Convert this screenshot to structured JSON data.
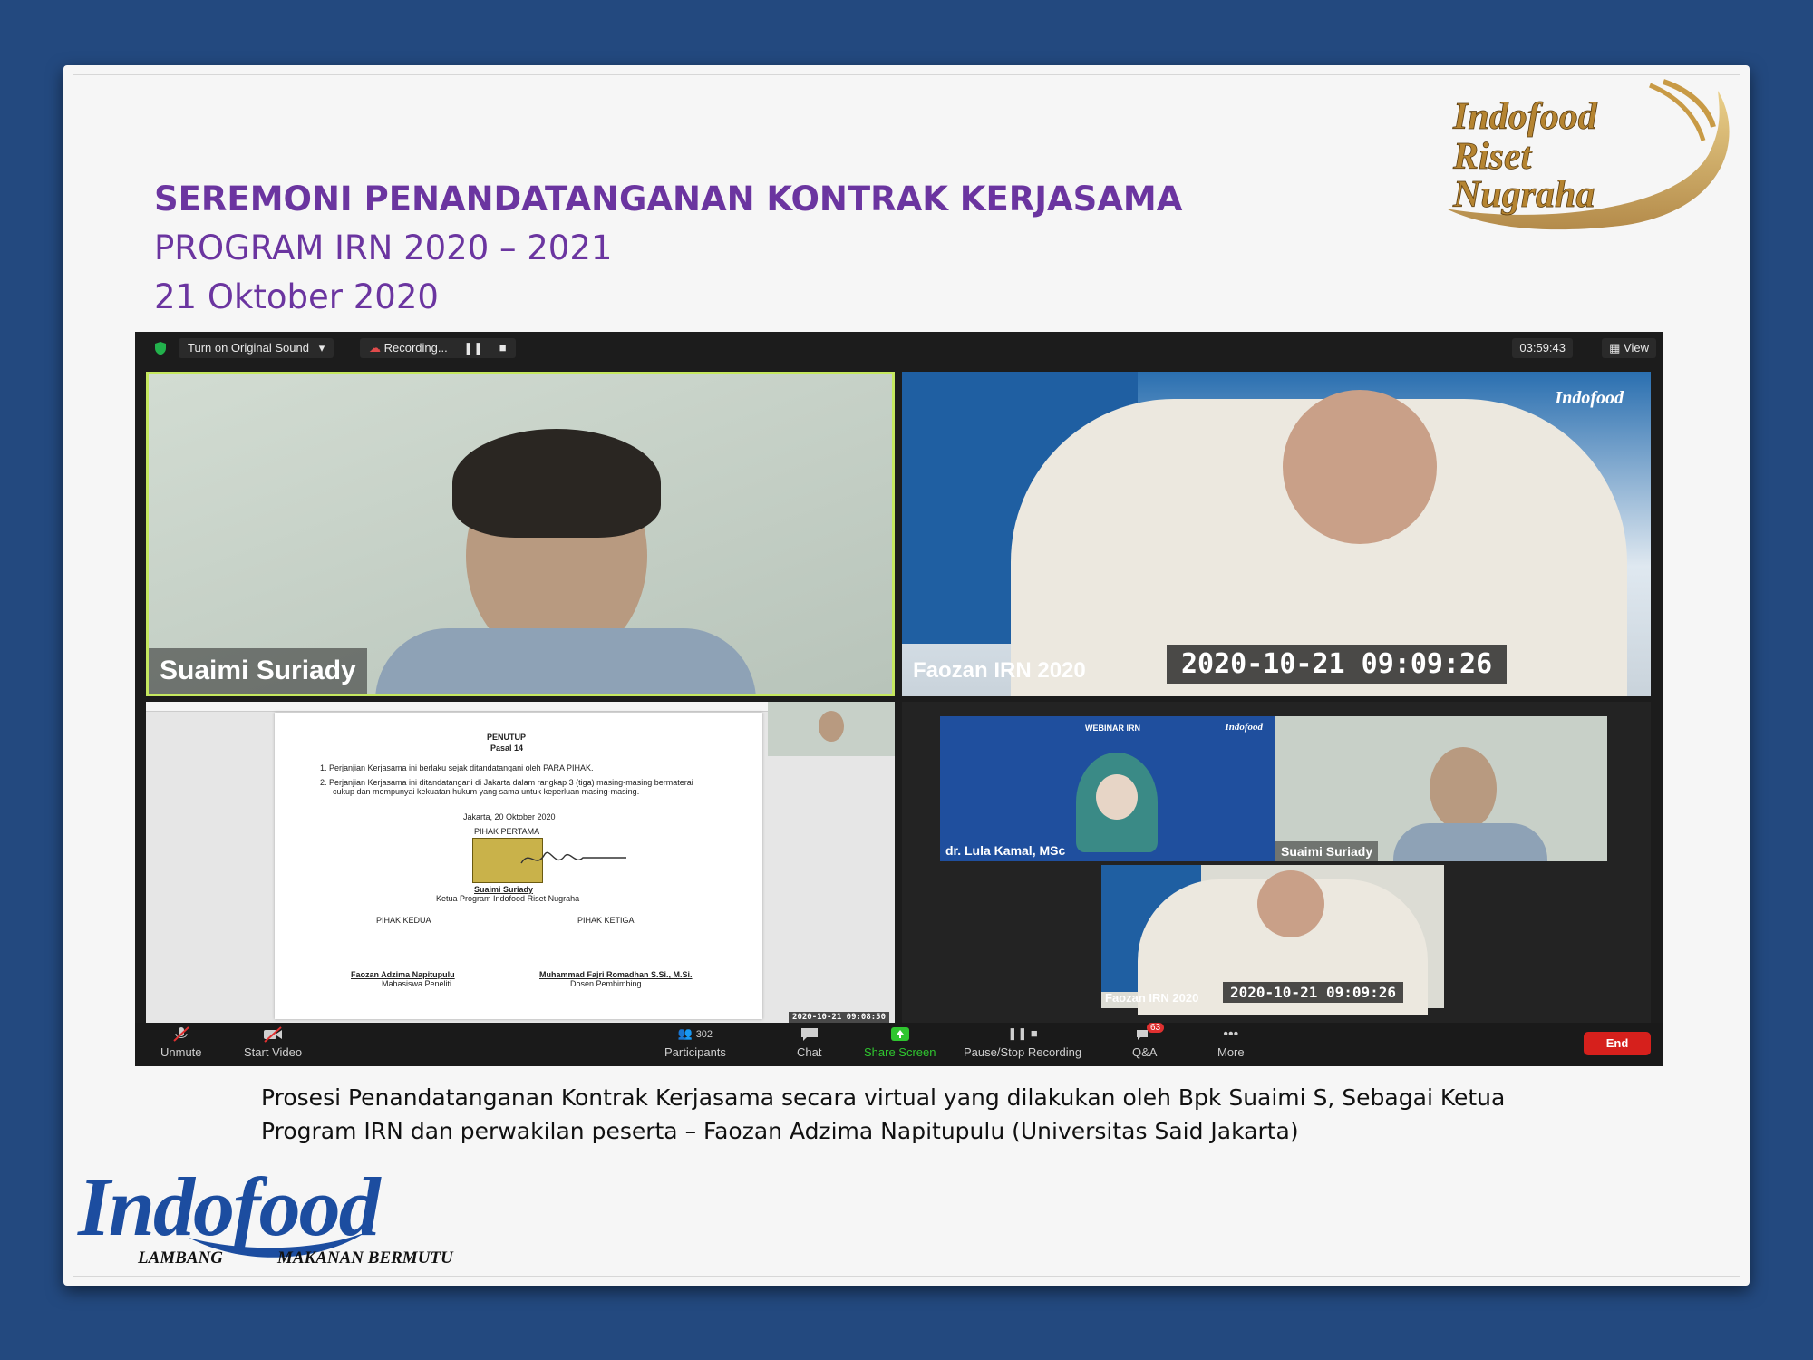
{
  "slide": {
    "title_line1": "SEREMONI PENANDATANGANAN KONTRAK KERJASAMA",
    "title_line2": "PROGRAM IRN 2020 – 2021",
    "title_line3": "21 Oktober 2020",
    "caption_line1": "Prosesi Penandatanganan Kontrak Kerjasama secara virtual yang dilakukan oleh Bpk Suaimi S, Sebagai Ketua",
    "caption_line2": "Program IRN dan perwakilan peserta – Faozan Adzima Napitupulu (Universitas Said Jakarta)"
  },
  "brand_top": {
    "line1": "Indofood",
    "line2": "Riset",
    "line3": "Nugraha"
  },
  "brand_bottom": {
    "word": "Indofood",
    "tag_left": "LAMBANG",
    "tag_right": "MAKANAN BERMUTU"
  },
  "zoom": {
    "topbar": {
      "original_sound": "Turn on Original Sound",
      "recording": "Recording...",
      "timer": "03:59:43",
      "view": "View"
    },
    "tiles": {
      "a_name": "Suaimi Suriady",
      "b_name": "Faozan IRN 2020",
      "b_stamp": "2020-10-21  09:09:26",
      "c_stamp": "2020-10-21  09:08:50",
      "d_name1": "dr. Lula Kamal, MSc",
      "d_name2": "Suaimi Suriady",
      "d_name3": "Faozan IRN 2020",
      "d_stamp": "2020-10-21  09:09:26",
      "d_webinar": "WEBINAR IRN",
      "d_badge": "Indofood",
      "b_badge": "Indofood"
    },
    "document": {
      "heading": "PENUTUP",
      "pasal": "Pasal 14",
      "item1": "1.   Perjanjian Kerjasama ini berlaku sejak ditandatangani oleh PARA PIHAK.",
      "item2a": "2.   Perjanjian Kerjasama ini ditandatangani di Jakarta dalam rangkap 3 (tiga) masing-masing bermaterai",
      "item2b": "cukup dan mempunyai kekuatan hukum yang sama untuk keperluan masing-masing.",
      "place_date": "Jakarta, 20 Oktober 2020",
      "pihak1": "PIHAK PERTAMA",
      "signer1": "Suaimi Suriady",
      "signer1_role": "Ketua Program Indofood Riset Nugraha",
      "pihak2": "PIHAK KEDUA",
      "pihak3": "PIHAK KETIGA",
      "signer2": "Faozan Adzima Napitupulu",
      "signer2_role": "Mahasiswa Peneliti",
      "signer3": "Muhammad Fajri Romadhan S.Si., M.Si.",
      "signer3_role": "Dosen Pembimbing"
    },
    "bottombar": {
      "unmute": "Unmute",
      "start_video": "Start Video",
      "participants": "Participants",
      "participants_count": "302",
      "chat": "Chat",
      "share": "Share Screen",
      "pause_record": "Pause/Stop Recording",
      "qa": "Q&A",
      "qa_count": "63",
      "more": "More",
      "end": "End"
    }
  },
  "colors": {
    "title": "#6b35a0",
    "frame": "#23497f",
    "share_green": "#2fc52f",
    "end_red": "#d6201c",
    "active_border": "#c5e85f"
  }
}
